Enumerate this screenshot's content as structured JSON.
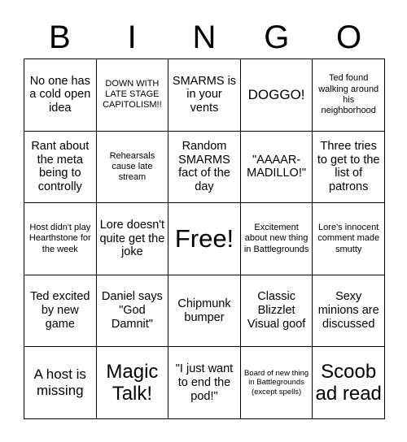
{
  "card": {
    "title": "BINGO",
    "header_letters": [
      "B",
      "I",
      "N",
      "G",
      "O"
    ],
    "grid_size": "5x5",
    "colors": {
      "background": "#ffffff",
      "text": "#000000",
      "grid_line": "#000000"
    },
    "cells": [
      {
        "col": "B",
        "row": 1,
        "text": "No one has a cold open idea",
        "size": "md"
      },
      {
        "col": "I",
        "row": 1,
        "text": "DOWN WITH LATE STAGE CAPITOLISM!!",
        "size": "sm"
      },
      {
        "col": "N",
        "row": 1,
        "text": "SMARMS is in your vents",
        "size": "md"
      },
      {
        "col": "G",
        "row": 1,
        "text": "DOGGO!",
        "size": "lg"
      },
      {
        "col": "O",
        "row": 1,
        "text": "Ted found walking around his neighborhood",
        "size": "sm"
      },
      {
        "col": "B",
        "row": 2,
        "text": "Rant about the meta being to controlly",
        "size": "md"
      },
      {
        "col": "I",
        "row": 2,
        "text": "Rehearsals cause late stream",
        "size": "sm"
      },
      {
        "col": "N",
        "row": 2,
        "text": "Random SMARMS fact of the day",
        "size": "md"
      },
      {
        "col": "G",
        "row": 2,
        "text": "\"AAAAR-MADILLO!\"",
        "size": "md"
      },
      {
        "col": "O",
        "row": 2,
        "text": "Three tries to get to the list of patrons",
        "size": "md"
      },
      {
        "col": "B",
        "row": 3,
        "text": "Host didn't play Hearthstone for the week",
        "size": "sm"
      },
      {
        "col": "I",
        "row": 3,
        "text": "Lore doesn't quite get the joke",
        "size": "md"
      },
      {
        "col": "N",
        "row": 3,
        "text": "Free!",
        "size": "xxl"
      },
      {
        "col": "G",
        "row": 3,
        "text": "Excitement about new thing in Battlegrounds",
        "size": "sm"
      },
      {
        "col": "O",
        "row": 3,
        "text": "Lore's innocent comment made smutty",
        "size": "sm"
      },
      {
        "col": "B",
        "row": 4,
        "text": "Ted excited by new game",
        "size": "md"
      },
      {
        "col": "I",
        "row": 4,
        "text": "Daniel says \"God Damnit\"",
        "size": "md"
      },
      {
        "col": "N",
        "row": 4,
        "text": "Chipmunk bumper",
        "size": "md"
      },
      {
        "col": "G",
        "row": 4,
        "text": "Classic Blizzlet Visual goof",
        "size": "md"
      },
      {
        "col": "O",
        "row": 4,
        "text": "Sexy minions are discussed",
        "size": "md"
      },
      {
        "col": "B",
        "row": 5,
        "text": "A host is missing",
        "size": "lg"
      },
      {
        "col": "I",
        "row": 5,
        "text": "Magic Talk!",
        "size": "xl"
      },
      {
        "col": "N",
        "row": 5,
        "text": "\"I just want to end the pod!\"",
        "size": "md"
      },
      {
        "col": "G",
        "row": 5,
        "text": "Board of new thing in Battlegrounds (except spells)",
        "size": "xs"
      },
      {
        "col": "O",
        "row": 5,
        "text": "Scoob ad read",
        "size": "xl"
      }
    ]
  }
}
